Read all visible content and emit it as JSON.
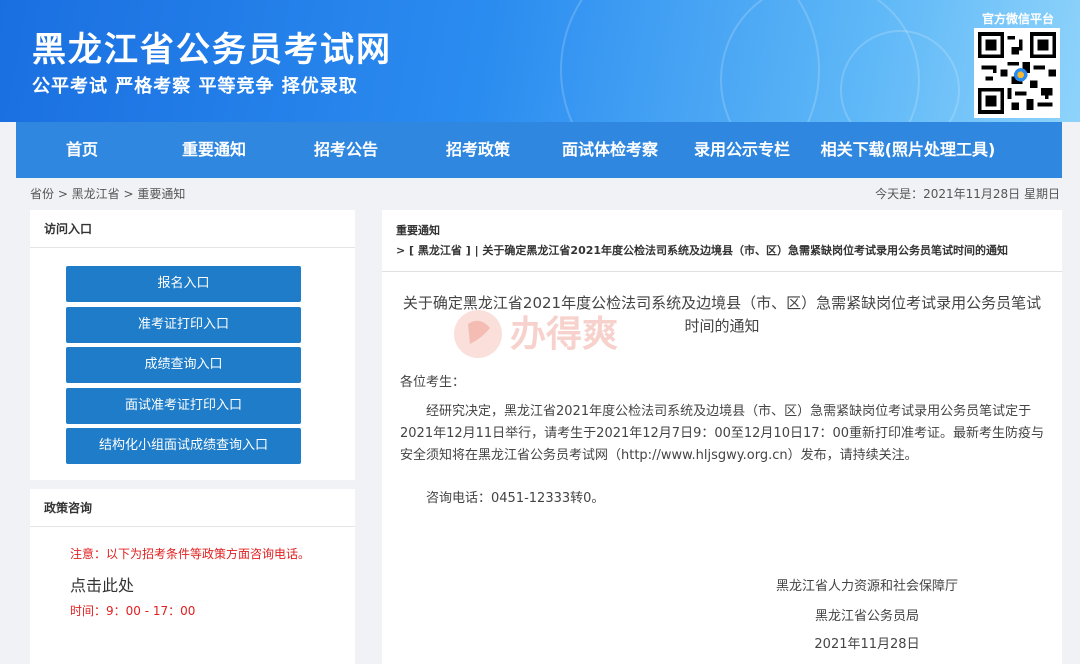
{
  "header": {
    "title": "黑龙江省公务员考试网",
    "slogan": "公平考试 严格考察 平等竞争 择优录取",
    "wechat_label": "官方微信平台",
    "qr_icon": "qr-code-icon"
  },
  "nav": {
    "items": [
      {
        "label": "首页"
      },
      {
        "label": "重要通知"
      },
      {
        "label": "招考公告"
      },
      {
        "label": "招考政策"
      },
      {
        "label": "面试体检考察"
      },
      {
        "label": "录用公示专栏"
      },
      {
        "label": "相关下载(照片处理工具)"
      }
    ]
  },
  "breadcrumb": {
    "text": "省份 > 黑龙江省 > 重要通知"
  },
  "today": {
    "text": "今天是：2021年11月28日 星期日"
  },
  "sidebar": {
    "access_title": "访问入口",
    "entries": [
      {
        "label": "报名入口"
      },
      {
        "label": "准考证打印入口"
      },
      {
        "label": "成绩查询入口"
      },
      {
        "label": "面试准考证打印入口"
      },
      {
        "label": "结构化小组面试成绩查询入口"
      }
    ],
    "policy_title": "政策咨询",
    "notice": "注意：以下为招考条件等政策方面咨询电话。",
    "click_here": "点击此处",
    "hours": "时间：9：00 - 17：00"
  },
  "content": {
    "section_label": "重要通知",
    "path_text": "> [ 黑龙江省 ] | 关于确定黑龙江省2021年度公检法司系统及边境县（市、区）急需紧缺岗位考试录用公务员笔试时间的通知",
    "title": "关于确定黑龙江省2021年度公检法司系统及边境县（市、区）急需紧缺岗位考试录用公务员笔试时间的通知",
    "watermark": "办得爽",
    "salutation": "各位考生：",
    "body": "经研究决定，黑龙江省2021年度公检法司系统及边境县（市、区）急需紧缺岗位考试录用公务员笔试定于2021年12月11日举行，请考生于2021年12月7日9：00至12月10日17：00重新打印准考证。最新考生防疫与安全须知将在黑龙江省公务员考试网（http://www.hljsgwy.org.cn）发布，请持续关注。",
    "phone": "咨询电话：0451-12333转0。",
    "sign1": "黑龙江省人力资源和社会保障厅",
    "sign2": "黑龙江省公务员局",
    "date": "2021年11月28日"
  },
  "colors": {
    "nav": "#2f87e0",
    "button": "#1e7cc8",
    "notice": "#e02020"
  }
}
